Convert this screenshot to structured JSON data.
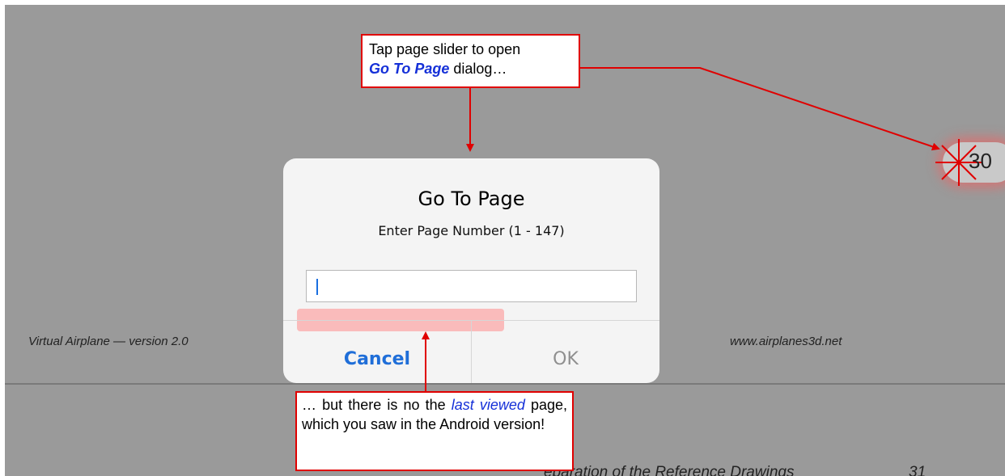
{
  "pdf_page": {
    "footer_left": "Virtual Airplane — version 2.0",
    "footer_right": "www.airplanes3d.net",
    "next_heading": "eparation of the Reference Drawings",
    "next_page_number": "31"
  },
  "page_slider": {
    "current_page": "30"
  },
  "dialog": {
    "title": "Go To Page",
    "message": "Enter Page Number (1 - 147)",
    "input_value": "",
    "cancel_label": "Cancel",
    "ok_label": "OK"
  },
  "callouts": {
    "top": {
      "line1": "Tap page slider to open",
      "highlight": "Go To Page",
      "line2_rest": " dialog…"
    },
    "bottom": {
      "prefix": "… but there is no the ",
      "highlight": "last viewed",
      "suffix": " page, which you saw in the Android version!"
    }
  },
  "colors": {
    "annotation_red": "#e00000",
    "highlight_blue": "#1530d8",
    "ios_blue": "#1f6ed8",
    "background_gray": "#9a9a9a"
  }
}
